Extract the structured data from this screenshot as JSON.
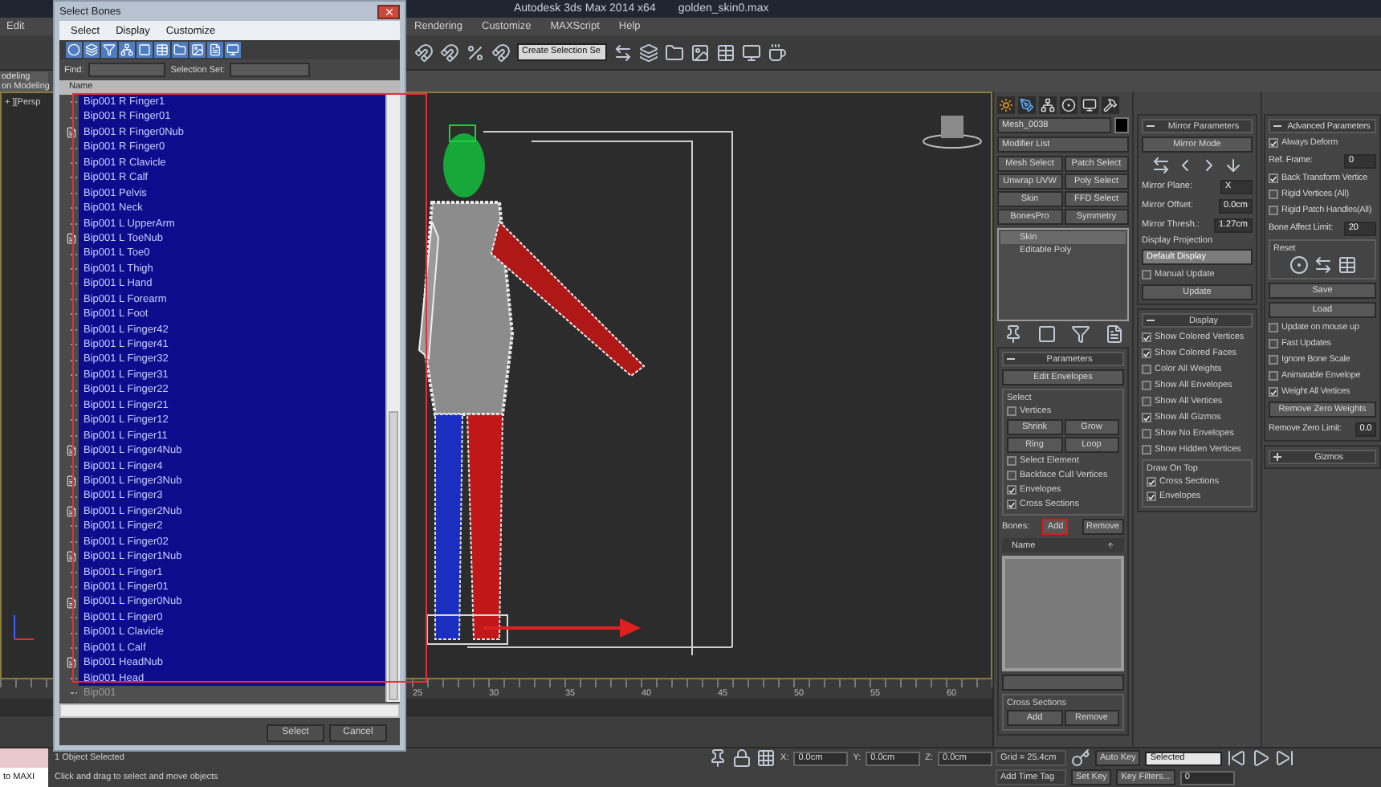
{
  "app": {
    "title": "Autodesk 3ds Max  2014 x64",
    "file": "golden_skin0.max",
    "menu_left": [
      "Edit"
    ],
    "menu": [
      "Rendering",
      "Customize",
      "MAXScript",
      "Help"
    ],
    "selection_set": "Create Selection Se",
    "ribbon_tab": "odeling",
    "ribbon_label": "on Modeling"
  },
  "viewport": {
    "label": "+ ][Persp"
  },
  "dialog": {
    "title": "Select Bones",
    "menu": [
      "Select",
      "Display",
      "Customize"
    ],
    "find_label": "Find:",
    "selection_set_label": "Selection Set:",
    "column": "Name",
    "buttons": [
      "Select",
      "Cancel"
    ],
    "items": [
      {
        "name": "Bip001 R Finger1",
        "kind": "bone",
        "selected": true
      },
      {
        "name": "Bip001 R Finger01",
        "kind": "bone",
        "selected": true
      },
      {
        "name": "Bip001 R Finger0Nub",
        "kind": "nub",
        "selected": true
      },
      {
        "name": "Bip001 R Finger0",
        "kind": "bone",
        "selected": true
      },
      {
        "name": "Bip001 R Clavicle",
        "kind": "bone",
        "selected": true
      },
      {
        "name": "Bip001 R Calf",
        "kind": "bone",
        "selected": true
      },
      {
        "name": "Bip001 Pelvis",
        "kind": "bone",
        "selected": true
      },
      {
        "name": "Bip001 Neck",
        "kind": "bone",
        "selected": true
      },
      {
        "name": "Bip001 L UpperArm",
        "kind": "bone",
        "selected": true
      },
      {
        "name": "Bip001 L ToeNub",
        "kind": "nub",
        "selected": true
      },
      {
        "name": "Bip001 L Toe0",
        "kind": "bone",
        "selected": true
      },
      {
        "name": "Bip001 L Thigh",
        "kind": "bone",
        "selected": true
      },
      {
        "name": "Bip001 L Hand",
        "kind": "bone",
        "selected": true
      },
      {
        "name": "Bip001 L Forearm",
        "kind": "bone",
        "selected": true
      },
      {
        "name": "Bip001 L Foot",
        "kind": "bone",
        "selected": true
      },
      {
        "name": "Bip001 L Finger42",
        "kind": "bone",
        "selected": true
      },
      {
        "name": "Bip001 L Finger41",
        "kind": "bone",
        "selected": true
      },
      {
        "name": "Bip001 L Finger32",
        "kind": "bone",
        "selected": true
      },
      {
        "name": "Bip001 L Finger31",
        "kind": "bone",
        "selected": true
      },
      {
        "name": "Bip001 L Finger22",
        "kind": "bone",
        "selected": true
      },
      {
        "name": "Bip001 L Finger21",
        "kind": "bone",
        "selected": true
      },
      {
        "name": "Bip001 L Finger12",
        "kind": "bone",
        "selected": true
      },
      {
        "name": "Bip001 L Finger11",
        "kind": "bone",
        "selected": true
      },
      {
        "name": "Bip001 L Finger4Nub",
        "kind": "nub",
        "selected": true
      },
      {
        "name": "Bip001 L Finger4",
        "kind": "bone",
        "selected": true
      },
      {
        "name": "Bip001 L Finger3Nub",
        "kind": "nub",
        "selected": true
      },
      {
        "name": "Bip001 L Finger3",
        "kind": "bone",
        "selected": true
      },
      {
        "name": "Bip001 L Finger2Nub",
        "kind": "nub",
        "selected": true
      },
      {
        "name": "Bip001 L Finger2",
        "kind": "bone",
        "selected": true
      },
      {
        "name": "Bip001 L Finger02",
        "kind": "bone",
        "selected": true
      },
      {
        "name": "Bip001 L Finger1Nub",
        "kind": "nub",
        "selected": true
      },
      {
        "name": "Bip001 L Finger1",
        "kind": "bone",
        "selected": true
      },
      {
        "name": "Bip001 L Finger01",
        "kind": "bone",
        "selected": true
      },
      {
        "name": "Bip001 L Finger0Nub",
        "kind": "nub",
        "selected": true
      },
      {
        "name": "Bip001 L Finger0",
        "kind": "bone",
        "selected": true
      },
      {
        "name": "Bip001 L Clavicle",
        "kind": "bone",
        "selected": true
      },
      {
        "name": "Bip001 L Calf",
        "kind": "bone",
        "selected": true
      },
      {
        "name": "Bip001 HeadNub",
        "kind": "nub",
        "selected": true
      },
      {
        "name": "Bip001 Head",
        "kind": "bone",
        "selected": true
      },
      {
        "name": "Bip001",
        "kind": "bone",
        "selected": false
      }
    ]
  },
  "command_panel": {
    "object_name": "Mesh_0038",
    "modifier_list": "Modifier List",
    "modifier_buttons": [
      "Mesh Select",
      "Patch Select",
      "Unwrap UVW",
      "Poly Select",
      "Skin",
      "FFD Select",
      "BonesPro",
      "Symmetry"
    ],
    "stack": [
      {
        "name": "Skin",
        "selected": true
      },
      {
        "name": "Editable Poly",
        "selected": false
      }
    ],
    "parameters": {
      "title": "Parameters",
      "expanded": true,
      "edit_envelopes": "Edit Envelopes",
      "select_group": "Select",
      "vertices": {
        "label": "Vertices",
        "checked": false
      },
      "select_buttons": [
        "Shrink",
        "Grow",
        "Ring",
        "Loop"
      ],
      "options": [
        {
          "label": "Select Element",
          "checked": false
        },
        {
          "label": "Backface Cull Vertices",
          "checked": false
        },
        {
          "label": "Envelopes",
          "checked": true
        },
        {
          "label": "Cross Sections",
          "checked": true
        }
      ],
      "bones_label": "Bones:",
      "add": {
        "label": "Add",
        "highlighted": true
      },
      "remove": "Remove",
      "name_header": "Name",
      "cross_sections": {
        "title": "Cross Sections",
        "buttons": [
          "Add",
          "Remove"
        ]
      }
    }
  },
  "mirror": {
    "title": "Mirror Parameters",
    "expanded": true,
    "mode": "Mirror Mode",
    "fields": [
      {
        "label": "Mirror Plane:",
        "value": "X"
      },
      {
        "label": "Mirror Offset:",
        "value": "0.0cm"
      },
      {
        "label": "Mirror Thresh.:",
        "value": "1.27cm"
      }
    ],
    "projection_label": "Display Projection",
    "projection": "Default Display",
    "manual_update": {
      "label": "Manual Update",
      "checked": false
    },
    "update": "Update"
  },
  "display": {
    "title": "Display",
    "expanded": true,
    "options": [
      {
        "label": "Show Colored Vertices",
        "checked": true
      },
      {
        "label": "Show Colored Faces",
        "checked": true
      },
      {
        "label": "Color All Weights",
        "checked": false
      },
      {
        "label": "Show All Envelopes",
        "checked": false
      },
      {
        "label": "Show All Vertices",
        "checked": false
      },
      {
        "label": "Show All Gizmos",
        "checked": true
      },
      {
        "label": "Show No Envelopes",
        "checked": false
      },
      {
        "label": "Show Hidden Vertices",
        "checked": false
      }
    ],
    "draw_on_top": {
      "title": "Draw On Top",
      "options": [
        {
          "label": "Cross Sections",
          "checked": true
        },
        {
          "label": "Envelopes",
          "checked": true
        }
      ]
    }
  },
  "advanced": {
    "title": "Advanced Parameters",
    "expanded": true,
    "always_deform": {
      "label": "Always Deform",
      "checked": true
    },
    "ref_frame": {
      "label": "Ref. Frame:",
      "value": "0"
    },
    "options": [
      {
        "label": "Back Transform Vertice",
        "checked": true
      },
      {
        "label": "Rigid Vertices (All)",
        "checked": false
      },
      {
        "label": "Rigid Patch Handles(All)",
        "checked": false
      }
    ],
    "bone_limit": {
      "label": "Bone Affect Limit:",
      "value": "20"
    },
    "reset": "Reset",
    "save": "Save",
    "load": "Load",
    "options2": [
      {
        "label": "Update on mouse up",
        "checked": false
      },
      {
        "label": "Fast Updates",
        "checked": false
      },
      {
        "label": "Ignore Bone Scale",
        "checked": false
      },
      {
        "label": "Animatable Envelope",
        "checked": false
      },
      {
        "label": "Weight All Vertices",
        "checked": true
      }
    ],
    "remove_zero": "Remove Zero Weights",
    "zero_limit": {
      "label": "Remove Zero Limit:",
      "value": "0.0"
    }
  },
  "gizmos": {
    "title": "Gizmos",
    "expanded": false
  },
  "timeline": {
    "ticks": [
      "25",
      "30",
      "35",
      "40",
      "45",
      "50",
      "55",
      "60"
    ]
  },
  "status": {
    "script": "to MAXI",
    "selected": "1 Object Selected",
    "prompt": "Click and drag to select and move objects",
    "coords": [
      {
        "axis": "X:",
        "value": "0.0cm"
      },
      {
        "axis": "Y:",
        "value": "0.0cm"
      },
      {
        "axis": "Z:",
        "value": "0.0cm"
      }
    ],
    "grid": "Grid = 25.4cm",
    "time_tag": "Add Time Tag"
  },
  "anim": {
    "auto_key": "Auto Key",
    "key_mode": "Selected",
    "set_key": "Set Key",
    "key_filters": "Key Filters...",
    "frame": "0"
  }
}
